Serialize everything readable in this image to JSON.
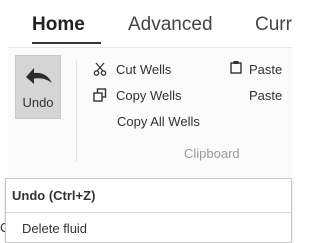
{
  "tabs": [
    {
      "label": "Home",
      "active": true
    },
    {
      "label": "Advanced",
      "active": false
    },
    {
      "label": "Curr",
      "active": false
    }
  ],
  "clipboard": {
    "undo_label": "Undo",
    "cut_label": "Cut Wells",
    "copy_label": "Copy Wells",
    "copy_all_label": "Copy All Wells",
    "paste_label": "Paste",
    "paste2_label": "Paste",
    "group_label": "Clipboard"
  },
  "tooltip": {
    "title": "Undo (Ctrl+Z)",
    "description": "Delete fluid",
    "behind_text": "C"
  },
  "icons": {
    "undo": "undo-arrow-icon",
    "cut": "scissors-icon",
    "copy": "copy-icon",
    "paste": "paste-icon"
  }
}
